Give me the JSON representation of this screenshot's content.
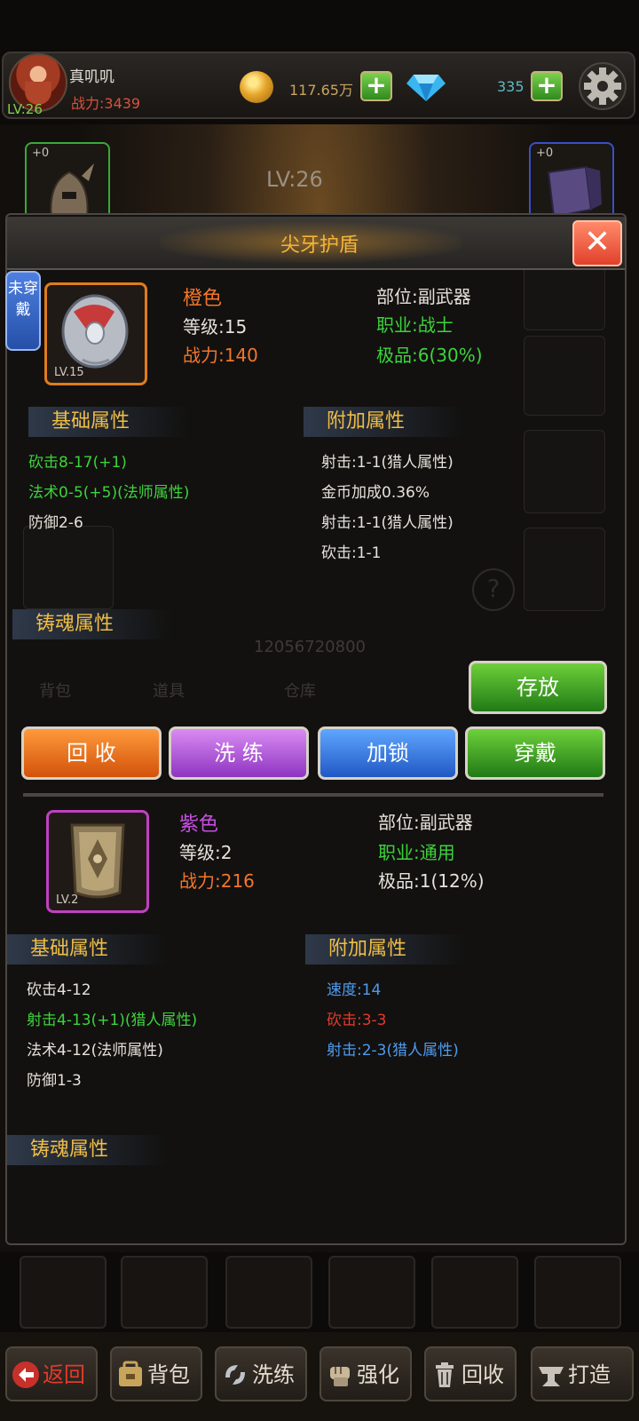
{
  "player": {
    "name": "真叽叽",
    "power": "战力:3439",
    "level": "LV:26"
  },
  "currency": {
    "gold": "117.65万",
    "gems": "335",
    "plus": "+"
  },
  "scene": {
    "center_level": "LV:26",
    "slot_plus": "+0",
    "id_text": "12056720800",
    "tabs": [
      "背包",
      "道具",
      "仓库"
    ]
  },
  "modal": {
    "title": "尖牙护盾",
    "close": "✕",
    "status_tag": "未穿戴",
    "item1": {
      "quality": "橙色",
      "level": "等级:15",
      "power": "战力:140",
      "icon_lv": "LV.15",
      "slot": "部位:副武器",
      "class": "职业:战士",
      "grade": "极品:6(30%)",
      "basic_header": "基础属性",
      "basic": [
        "砍击8-17(+1)",
        "法术0-5(+5)(法师属性)",
        "防御2-6"
      ],
      "extra_header": "附加属性",
      "extra": [
        "射击:1-1(猎人属性)",
        "金币加成0.36%",
        "射击:1-1(猎人属性)",
        "砍击:1-1"
      ],
      "soul_header": "铸魂属性"
    },
    "store_button": "存放",
    "actions": {
      "recycle": "回 收",
      "refine": "洗 练",
      "lock": "加锁",
      "equip": "穿戴"
    },
    "item2": {
      "quality": "紫色",
      "level": "等级:2",
      "power": "战力:216",
      "icon_lv": "LV.2",
      "slot": "部位:副武器",
      "class": "职业:通用",
      "grade": "极品:1(12%)",
      "basic_header": "基础属性",
      "basic": [
        "砍击4-12",
        "射击4-13(+1)(猎人属性)",
        "法术4-12(法师属性)",
        "防御1-3"
      ],
      "extra_header": "附加属性",
      "extra": [
        "速度:14",
        "砍击:3-3",
        "射击:2-3(猎人属性)"
      ],
      "soul_header": "铸魂属性"
    }
  },
  "nav": {
    "back": "返回",
    "bag": "背包",
    "refine": "洗练",
    "enhance": "强化",
    "recycle": "回收",
    "forge": "打造"
  },
  "colors": {
    "accent_gold": "#f0bd45",
    "quality_orange": "#e07c1c",
    "quality_purple": "#c040c0",
    "stat_green": "#3ed33b"
  }
}
